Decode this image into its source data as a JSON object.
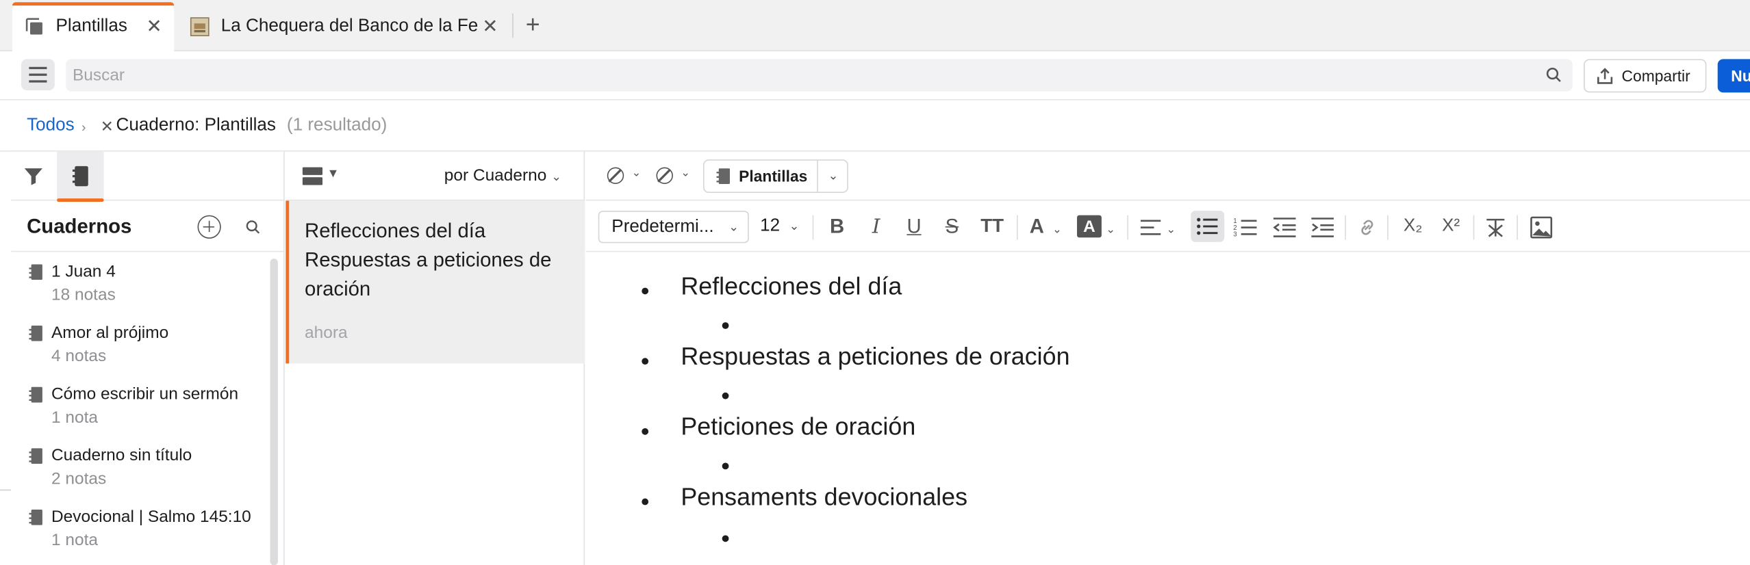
{
  "tabs": [
    {
      "label": "Plantillas",
      "active": true
    },
    {
      "label": "La Chequera del Banco de la Fe",
      "active": false
    }
  ],
  "toolbar": {
    "search_placeholder": "Buscar",
    "share_label": "Compartir",
    "new_label": "Nu"
  },
  "breadcrumb": {
    "all": "Todos",
    "filter": "Cuaderno: Plantillas",
    "count": "(1 resultado)"
  },
  "sidebar": {
    "title": "Cuadernos",
    "notebooks": [
      {
        "name": "1 Juan 4",
        "count": "18 notas"
      },
      {
        "name": "Amor al prójimo",
        "count": "4 notas"
      },
      {
        "name": "Cómo escribir un sermón",
        "count": "1 nota"
      },
      {
        "name": "Cuaderno sin título",
        "count": "2 notas"
      },
      {
        "name": "Devocional | Salmo 145:10",
        "count": "1 nota"
      }
    ]
  },
  "notes_list": {
    "sort_label": "por Cuaderno",
    "notes": [
      {
        "title": "Reflecciones del día Respuestas a peticiones de oración",
        "time": "ahora"
      }
    ]
  },
  "editor": {
    "notebook_pill": "Plantillas",
    "font": "Predetermi...",
    "size": "12",
    "headings": [
      "Reflecciones del día",
      "Respuestas a peticiones de oración",
      "Peticiones de oración",
      "Pensaments devocionales"
    ]
  },
  "colors": {
    "accent": "#f06f22",
    "link": "#1765cc",
    "primary_button": "#0b5ed7"
  }
}
